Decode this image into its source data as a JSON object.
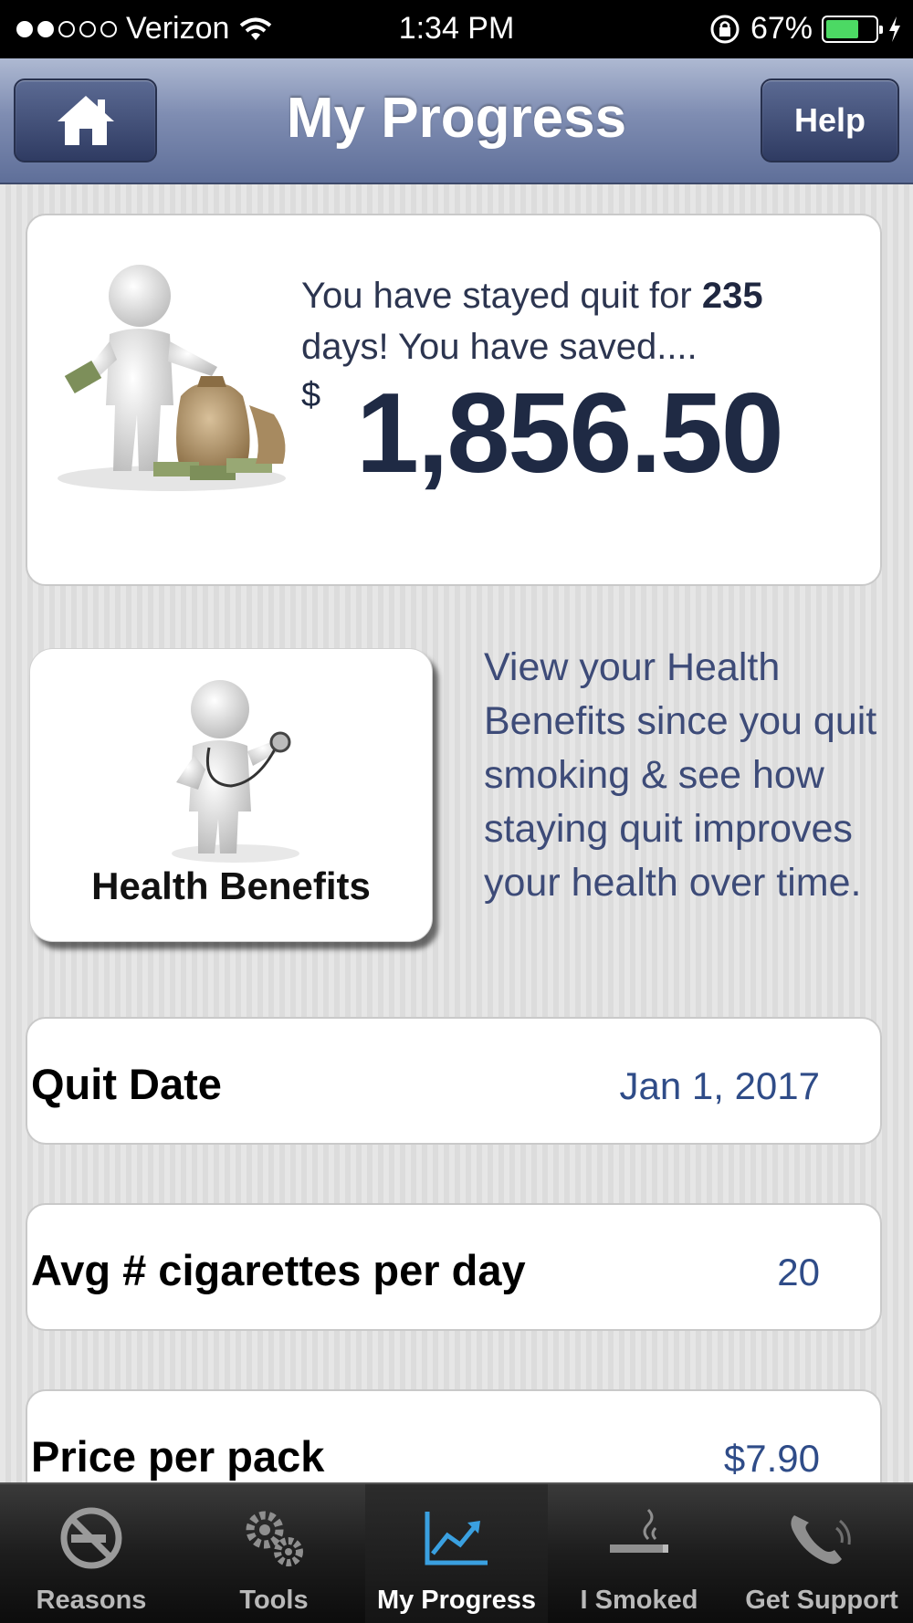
{
  "status_bar": {
    "carrier": "Verizon",
    "time": "1:34 PM",
    "battery_percent": "67%",
    "battery_level": 0.67,
    "signal_bars_filled": 2,
    "signal_bars_total": 5
  },
  "header": {
    "title": "My Progress",
    "home_icon": "home-icon",
    "help_label": "Help"
  },
  "savings": {
    "line1_prefix": "You have stayed quit for",
    "days": "235",
    "line2": "days!  You have saved....",
    "currency": "$",
    "amount": "1,856.50"
  },
  "health": {
    "button_label": "Health Benefits",
    "description": "View your Health Benefits since you quit smoking & see how staying quit improves your health over time."
  },
  "rows": [
    {
      "label": "Quit Date",
      "value": "Jan 1, 2017"
    },
    {
      "label": "Avg # cigarettes per day",
      "value": "20"
    },
    {
      "label": "Price per pack",
      "value": "$7.90"
    }
  ],
  "tabs": [
    {
      "label": "Reasons",
      "icon": "no-smoking-icon"
    },
    {
      "label": "Tools",
      "icon": "gears-icon"
    },
    {
      "label": "My Progress",
      "icon": "chart-icon",
      "active": true
    },
    {
      "label": "I Smoked",
      "icon": "cigarette-icon"
    },
    {
      "label": "Get Support",
      "icon": "phone-icon"
    }
  ],
  "colors": {
    "nav_bar": "#7f8db2",
    "accent_value": "#2f4c88",
    "active_tab_icon": "#3aa0e0",
    "battery_fill": "#4cd964"
  }
}
